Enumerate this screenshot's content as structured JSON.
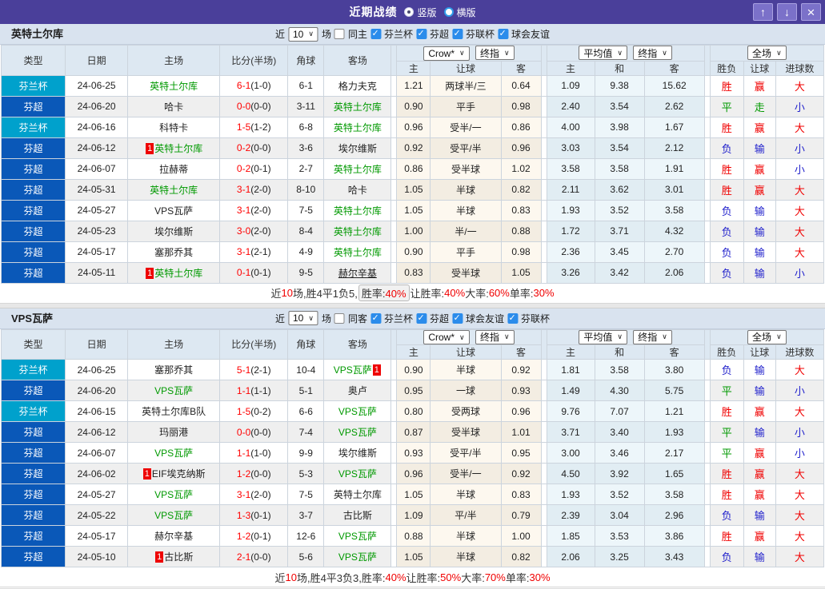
{
  "titlebar": {
    "title": "近期战绩",
    "vertical_label": "竖版",
    "horizontal_label": "横版",
    "buttons": {
      "up": "↑",
      "down": "↓",
      "close": "×"
    }
  },
  "colors": {
    "titlebar_bg": "#4a3f9a",
    "cup_type_bg": "#00a1cc",
    "league_type_bg": "#0a58b8",
    "badge_bg": "#ee0000",
    "highlight_team_green": "#009900",
    "win_red": "#f00000",
    "draw_green": "#009900",
    "lose_blue": "#2222cc"
  },
  "selects": {
    "crow": "Crow*",
    "final": "终指",
    "avg": "平均值",
    "full": "全场"
  },
  "columns": {
    "left": [
      "类型",
      "日期",
      "主场",
      "比分(半场)",
      "角球",
      "客场"
    ],
    "crow": [
      "主",
      "让球",
      "客"
    ],
    "avg": [
      "主",
      "和",
      "客"
    ],
    "result": [
      "胜负",
      "让球",
      "进球数"
    ]
  },
  "result_color_map": {
    "胜": "red",
    "平": "green",
    "负": "blue",
    "赢": "red",
    "走": "green",
    "输": "blue",
    "大": "red",
    "小": "blue"
  },
  "tables": [
    {
      "team": "英特土尔库",
      "filter": {
        "near": "近",
        "count": "10",
        "games": "场",
        "same": "同主",
        "leagues": [
          "芬兰杯",
          "芬超",
          "芬联杯",
          "球会友谊"
        ]
      },
      "rows": [
        {
          "league": "芬兰杯",
          "kind": "cup",
          "date": "24-06-25",
          "home": {
            "name": "英特土尔库",
            "green": true
          },
          "score_full": "6-1",
          "score_half": "(1-0)",
          "corners": "6-1",
          "away": {
            "name": "格力夫克"
          },
          "crow": [
            "1.21",
            "两球半/三",
            "0.64"
          ],
          "avg": [
            "1.09",
            "9.38",
            "15.62"
          ],
          "outcome": [
            "胜",
            "赢",
            "大"
          ]
        },
        {
          "league": "芬超",
          "kind": "league",
          "date": "24-06-20",
          "home": {
            "name": "哈卡"
          },
          "score_full": "0-0",
          "score_half": "(0-0)",
          "corners": "3-11",
          "away": {
            "name": "英特土尔库",
            "green": true
          },
          "crow": [
            "0.90",
            "平手",
            "0.98"
          ],
          "avg": [
            "2.40",
            "3.54",
            "2.62"
          ],
          "outcome": [
            "平",
            "走",
            "小"
          ]
        },
        {
          "league": "芬兰杯",
          "kind": "cup",
          "date": "24-06-16",
          "home": {
            "name": "科特卡"
          },
          "score_full": "1-5",
          "score_half": "(1-2)",
          "corners": "6-8",
          "away": {
            "name": "英特土尔库",
            "green": true
          },
          "crow": [
            "0.96",
            "受半/一",
            "0.86"
          ],
          "avg": [
            "4.00",
            "3.98",
            "1.67"
          ],
          "outcome": [
            "胜",
            "赢",
            "大"
          ]
        },
        {
          "league": "芬超",
          "kind": "league",
          "date": "24-06-12",
          "home": {
            "name": "英特土尔库",
            "green": true,
            "badge": "1",
            "badge_pos": "before"
          },
          "score_full": "0-2",
          "score_half": "(0-0)",
          "corners": "3-6",
          "away": {
            "name": "埃尔维斯"
          },
          "crow": [
            "0.92",
            "受平/半",
            "0.96"
          ],
          "avg": [
            "3.03",
            "3.54",
            "2.12"
          ],
          "outcome": [
            "负",
            "输",
            "小"
          ]
        },
        {
          "league": "芬超",
          "kind": "league",
          "date": "24-06-07",
          "home": {
            "name": "拉赫蒂"
          },
          "score_full": "0-2",
          "score_half": "(0-1)",
          "corners": "2-7",
          "away": {
            "name": "英特土尔库",
            "green": true
          },
          "crow": [
            "0.86",
            "受半球",
            "1.02"
          ],
          "avg": [
            "3.58",
            "3.58",
            "1.91"
          ],
          "outcome": [
            "胜",
            "赢",
            "小"
          ]
        },
        {
          "league": "芬超",
          "kind": "league",
          "date": "24-05-31",
          "home": {
            "name": "英特土尔库",
            "green": true
          },
          "score_full": "3-1",
          "score_half": "(2-0)",
          "corners": "8-10",
          "away": {
            "name": "哈卡"
          },
          "crow": [
            "1.05",
            "半球",
            "0.82"
          ],
          "avg": [
            "2.11",
            "3.62",
            "3.01"
          ],
          "outcome": [
            "胜",
            "赢",
            "大"
          ]
        },
        {
          "league": "芬超",
          "kind": "league",
          "date": "24-05-27",
          "home": {
            "name": "VPS瓦萨"
          },
          "score_full": "3-1",
          "score_half": "(2-0)",
          "corners": "7-5",
          "away": {
            "name": "英特土尔库",
            "green": true
          },
          "crow": [
            "1.05",
            "半球",
            "0.83"
          ],
          "avg": [
            "1.93",
            "3.52",
            "3.58"
          ],
          "outcome": [
            "负",
            "输",
            "大"
          ]
        },
        {
          "league": "芬超",
          "kind": "league",
          "date": "24-05-23",
          "home": {
            "name": "埃尔维斯"
          },
          "score_full": "3-0",
          "score_half": "(2-0)",
          "corners": "8-4",
          "away": {
            "name": "英特土尔库",
            "green": true
          },
          "crow": [
            "1.00",
            "半/一",
            "0.88"
          ],
          "avg": [
            "1.72",
            "3.71",
            "4.32"
          ],
          "outcome": [
            "负",
            "输",
            "大"
          ]
        },
        {
          "league": "芬超",
          "kind": "league",
          "date": "24-05-17",
          "home": {
            "name": "塞那乔其"
          },
          "score_full": "3-1",
          "score_half": "(2-1)",
          "corners": "4-9",
          "away": {
            "name": "英特土尔库",
            "green": true
          },
          "crow": [
            "0.90",
            "平手",
            "0.98"
          ],
          "avg": [
            "2.36",
            "3.45",
            "2.70"
          ],
          "outcome": [
            "负",
            "输",
            "大"
          ]
        },
        {
          "league": "芬超",
          "kind": "league",
          "date": "24-05-11",
          "home": {
            "name": "英特土尔库",
            "green": true,
            "badge": "1",
            "badge_pos": "before"
          },
          "score_full": "0-1",
          "score_half": "(0-1)",
          "corners": "9-5",
          "away": {
            "name": "赫尔辛基",
            "underline": true
          },
          "crow": [
            "0.83",
            "受半球",
            "1.05"
          ],
          "avg": [
            "3.26",
            "3.42",
            "2.06"
          ],
          "outcome": [
            "负",
            "输",
            "小"
          ]
        }
      ],
      "footer": [
        {
          "text": "近",
          "red": false
        },
        {
          "text": "10",
          "red": true
        },
        {
          "text": "场,胜4平1负5, ",
          "red": false
        },
        {
          "text": "胜率:",
          "red": false,
          "boxed": true
        },
        {
          "text": "40%",
          "red": true,
          "boxed": true
        },
        {
          "text": " 让胜率:",
          "red": false
        },
        {
          "text": "40%",
          "red": true
        },
        {
          "text": " 大率:",
          "red": false
        },
        {
          "text": "60%",
          "red": true
        },
        {
          "text": " 单率:",
          "red": false
        },
        {
          "text": "30%",
          "red": true
        }
      ]
    },
    {
      "team": "VPS瓦萨",
      "filter": {
        "near": "近",
        "count": "10",
        "games": "场",
        "same": "同客",
        "leagues": [
          "芬兰杯",
          "芬超",
          "球会友谊",
          "芬联杯"
        ]
      },
      "rows": [
        {
          "league": "芬兰杯",
          "kind": "cup",
          "date": "24-06-25",
          "home": {
            "name": "塞那乔其"
          },
          "score_full": "5-1",
          "score_half": "(2-1)",
          "corners": "10-4",
          "away": {
            "name": "VPS瓦萨",
            "green": true,
            "badge": "1",
            "badge_pos": "after"
          },
          "crow": [
            "0.90",
            "半球",
            "0.92"
          ],
          "avg": [
            "1.81",
            "3.58",
            "3.80"
          ],
          "outcome": [
            "负",
            "输",
            "大"
          ]
        },
        {
          "league": "芬超",
          "kind": "league",
          "date": "24-06-20",
          "home": {
            "name": "VPS瓦萨",
            "green": true
          },
          "score_full": "1-1",
          "score_half": "(1-1)",
          "corners": "5-1",
          "away": {
            "name": "奥卢"
          },
          "crow": [
            "0.95",
            "一球",
            "0.93"
          ],
          "avg": [
            "1.49",
            "4.30",
            "5.75"
          ],
          "outcome": [
            "平",
            "输",
            "小"
          ]
        },
        {
          "league": "芬兰杯",
          "kind": "cup",
          "date": "24-06-15",
          "home": {
            "name": "英特土尔库B队"
          },
          "score_full": "1-5",
          "score_half": "(0-2)",
          "corners": "6-6",
          "away": {
            "name": "VPS瓦萨",
            "green": true
          },
          "crow": [
            "0.80",
            "受两球",
            "0.96"
          ],
          "avg": [
            "9.76",
            "7.07",
            "1.21"
          ],
          "outcome": [
            "胜",
            "赢",
            "大"
          ]
        },
        {
          "league": "芬超",
          "kind": "league",
          "date": "24-06-12",
          "home": {
            "name": "玛丽港"
          },
          "score_full": "0-0",
          "score_half": "(0-0)",
          "corners": "7-4",
          "away": {
            "name": "VPS瓦萨",
            "green": true
          },
          "crow": [
            "0.87",
            "受半球",
            "1.01"
          ],
          "avg": [
            "3.71",
            "3.40",
            "1.93"
          ],
          "outcome": [
            "平",
            "输",
            "小"
          ]
        },
        {
          "league": "芬超",
          "kind": "league",
          "date": "24-06-07",
          "home": {
            "name": "VPS瓦萨",
            "green": true
          },
          "score_full": "1-1",
          "score_half": "(1-0)",
          "corners": "9-9",
          "away": {
            "name": "埃尔维斯"
          },
          "crow": [
            "0.93",
            "受平/半",
            "0.95"
          ],
          "avg": [
            "3.00",
            "3.46",
            "2.17"
          ],
          "outcome": [
            "平",
            "赢",
            "小"
          ]
        },
        {
          "league": "芬超",
          "kind": "league",
          "date": "24-06-02",
          "home": {
            "name": "EIF埃克纳斯",
            "badge": "1",
            "badge_pos": "before"
          },
          "score_full": "1-2",
          "score_half": "(0-0)",
          "corners": "5-3",
          "away": {
            "name": "VPS瓦萨",
            "green": true
          },
          "crow": [
            "0.96",
            "受半/一",
            "0.92"
          ],
          "avg": [
            "4.50",
            "3.92",
            "1.65"
          ],
          "outcome": [
            "胜",
            "赢",
            "大"
          ]
        },
        {
          "league": "芬超",
          "kind": "league",
          "date": "24-05-27",
          "home": {
            "name": "VPS瓦萨",
            "green": true
          },
          "score_full": "3-1",
          "score_half": "(2-0)",
          "corners": "7-5",
          "away": {
            "name": "英特土尔库"
          },
          "crow": [
            "1.05",
            "半球",
            "0.83"
          ],
          "avg": [
            "1.93",
            "3.52",
            "3.58"
          ],
          "outcome": [
            "胜",
            "赢",
            "大"
          ]
        },
        {
          "league": "芬超",
          "kind": "league",
          "date": "24-05-22",
          "home": {
            "name": "VPS瓦萨",
            "green": true
          },
          "score_full": "1-3",
          "score_half": "(0-1)",
          "corners": "3-7",
          "away": {
            "name": "古比斯"
          },
          "crow": [
            "1.09",
            "平/半",
            "0.79"
          ],
          "avg": [
            "2.39",
            "3.04",
            "2.96"
          ],
          "outcome": [
            "负",
            "输",
            "大"
          ]
        },
        {
          "league": "芬超",
          "kind": "league",
          "date": "24-05-17",
          "home": {
            "name": "赫尔辛基"
          },
          "score_full": "1-2",
          "score_half": "(0-1)",
          "corners": "12-6",
          "away": {
            "name": "VPS瓦萨",
            "green": true
          },
          "crow": [
            "0.88",
            "半球",
            "1.00"
          ],
          "avg": [
            "1.85",
            "3.53",
            "3.86"
          ],
          "outcome": [
            "胜",
            "赢",
            "大"
          ]
        },
        {
          "league": "芬超",
          "kind": "league",
          "date": "24-05-10",
          "home": {
            "name": "古比斯",
            "badge": "1",
            "badge_pos": "before"
          },
          "score_full": "2-1",
          "score_half": "(0-0)",
          "corners": "5-6",
          "away": {
            "name": "VPS瓦萨",
            "green": true
          },
          "crow": [
            "1.05",
            "半球",
            "0.82"
          ],
          "avg": [
            "2.06",
            "3.25",
            "3.43"
          ],
          "outcome": [
            "负",
            "输",
            "大"
          ]
        }
      ],
      "footer": [
        {
          "text": "近",
          "red": false
        },
        {
          "text": "10",
          "red": true
        },
        {
          "text": "场,胜4平3负3, ",
          "red": false
        },
        {
          "text": "胜率:",
          "red": false
        },
        {
          "text": "40%",
          "red": true
        },
        {
          "text": " 让胜率:",
          "red": false
        },
        {
          "text": "50%",
          "red": true
        },
        {
          "text": " 大率:",
          "red": false
        },
        {
          "text": "70%",
          "red": true
        },
        {
          "text": " 单率:",
          "red": false
        },
        {
          "text": "30%",
          "red": true
        }
      ]
    }
  ]
}
